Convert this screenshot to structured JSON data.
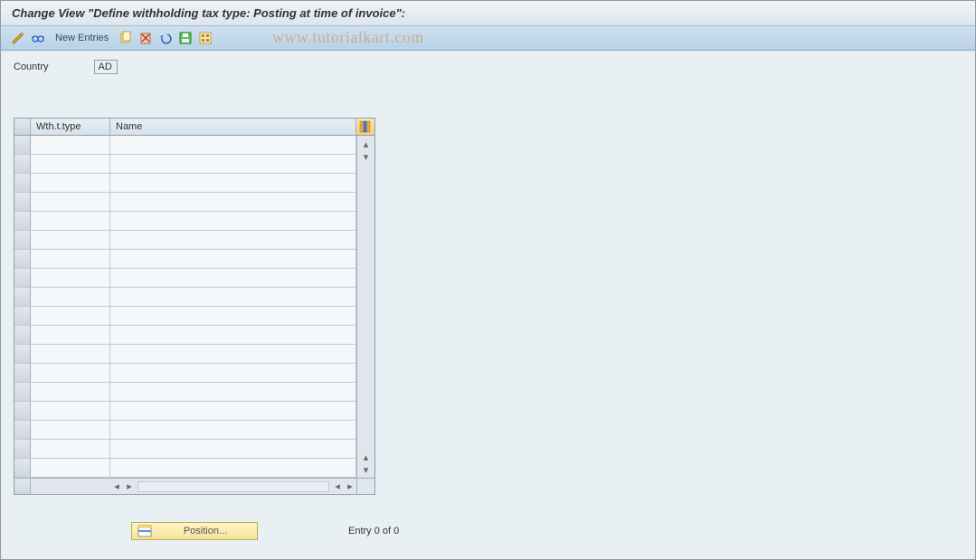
{
  "title": "Change View \"Define withholding tax type: Posting at time of invoice\":",
  "toolbar": {
    "new_entries_label": "New Entries"
  },
  "watermark": "www.tutorialkart.com",
  "country": {
    "label": "Country",
    "value": "AD"
  },
  "table": {
    "columns": {
      "col1": "Wth.t.type",
      "col2": "Name"
    },
    "row_count": 18
  },
  "footer": {
    "position_label": "Position...",
    "entry_text": "Entry 0 of 0"
  }
}
